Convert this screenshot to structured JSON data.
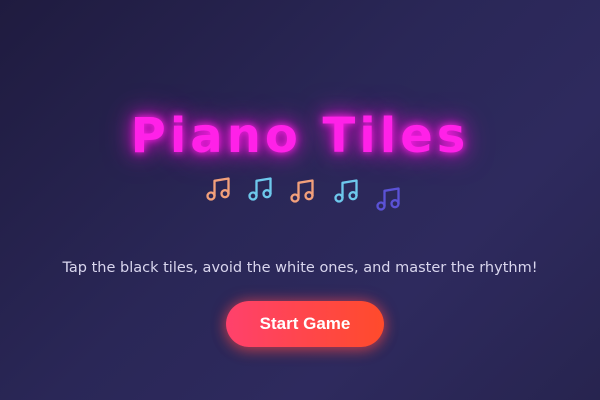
{
  "title": "Piano Tiles",
  "subtitle": "Tap the black tiles, avoid the white ones, and master the rhythm!",
  "start_button": "Start Game",
  "notes": [
    {
      "icon": "music-note-icon",
      "color": "#f2a07b"
    },
    {
      "icon": "music-note-icon",
      "color": "#6ec8ec"
    },
    {
      "icon": "music-note-icon",
      "color": "#f2a07b"
    },
    {
      "icon": "music-note-icon",
      "color": "#6ec8ec"
    },
    {
      "icon": "music-note-icon",
      "color": "#5b52d6"
    }
  ],
  "colors": {
    "title_glow": "#ff21e8",
    "button_start": "#ff416c",
    "button_end": "#ff4b2b",
    "background": "#2a2757"
  }
}
